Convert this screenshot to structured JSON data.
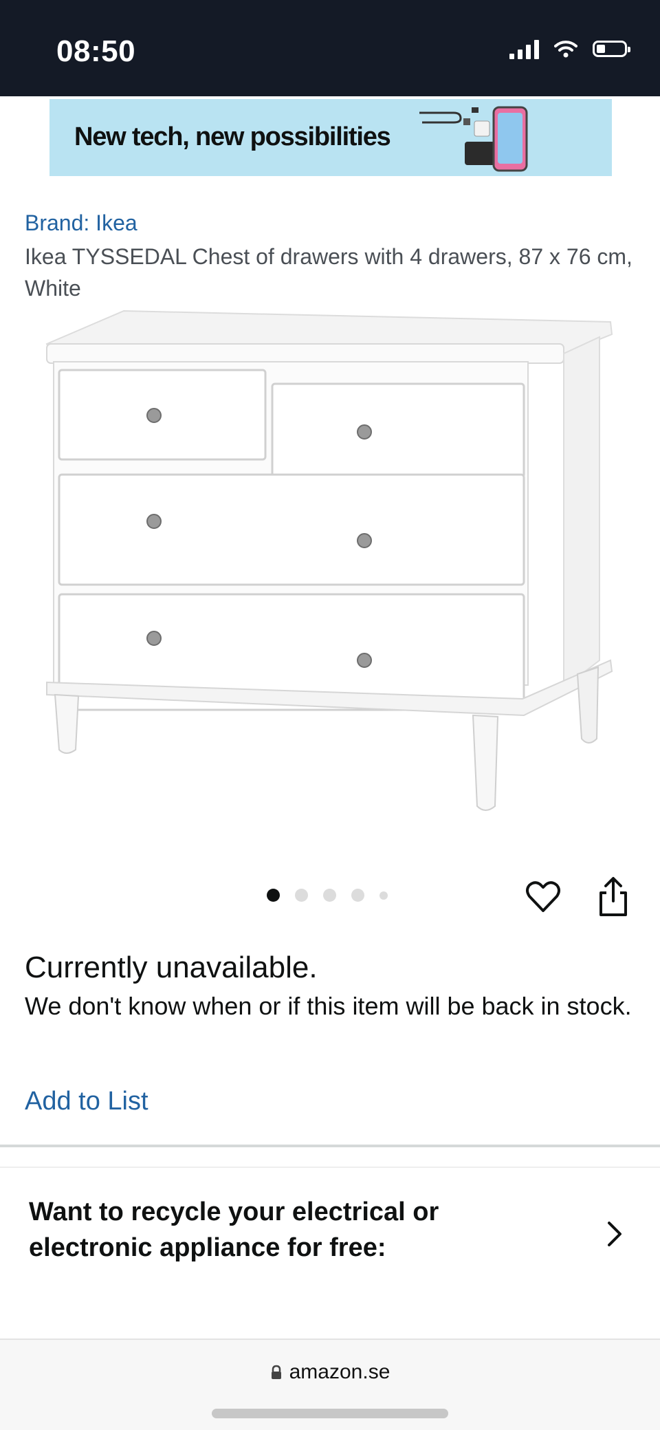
{
  "status_bar": {
    "time": "08:50",
    "icons": [
      "signal-icon",
      "wifi-icon",
      "battery-icon"
    ]
  },
  "banner": {
    "text": "New tech, new possibilities"
  },
  "product": {
    "brand_link": "Brand: Ikea",
    "title": "Ikea TYSSEDAL Chest of drawers with 4 drawers, 87 x 76 cm, White",
    "image_index": 1,
    "image_count": 5
  },
  "availability": {
    "status": "Currently unavailable.",
    "note": "We don't know when or if this item will be back in stock."
  },
  "actions": {
    "add_to_list": "Add to List",
    "icons": [
      "heart-icon",
      "share-icon"
    ]
  },
  "recycle": {
    "text": "Want to recycle your electrical or electronic appliance for free:"
  },
  "browser": {
    "url": "amazon.se"
  },
  "colors": {
    "status_bar_bg": "#141a26",
    "banner_bg": "#b9e3f2",
    "link": "#2162a1"
  }
}
